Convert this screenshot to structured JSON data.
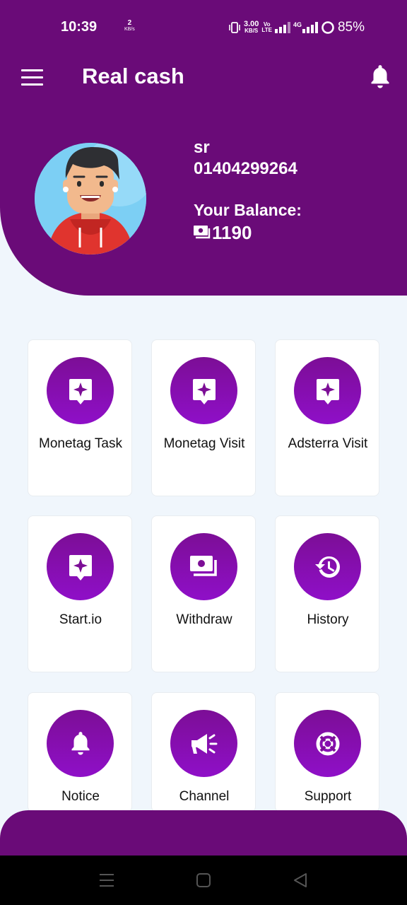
{
  "status_bar": {
    "time": "10:39",
    "net_speed_left_value": "2",
    "net_speed_left_unit": "KB/s",
    "net_speed_right_value": "3.00",
    "net_speed_right_unit": "KB/S",
    "volte_top": "Vo",
    "volte_bottom": "LTE",
    "network_type": "4G",
    "battery": "85%"
  },
  "app_bar": {
    "title": "Real cash",
    "menu_icon": "menu-icon",
    "notification_icon": "bell-icon"
  },
  "profile": {
    "name": "sr",
    "phone": "01404299264",
    "balance_label": "Your Balance:",
    "balance_value": "1190",
    "balance_icon": "money-icon"
  },
  "tiles": [
    {
      "label": "Monetag Task",
      "icon": "sparkle-message-icon"
    },
    {
      "label": "Monetag Visit",
      "icon": "sparkle-message-icon"
    },
    {
      "label": "Adsterra Visit",
      "icon": "sparkle-message-icon"
    },
    {
      "label": "Start.io",
      "icon": "sparkle-message-icon"
    },
    {
      "label": "Withdraw",
      "icon": "money-icon"
    },
    {
      "label": "History",
      "icon": "history-icon"
    },
    {
      "label": "Notice",
      "icon": "bell-icon"
    },
    {
      "label": "Channel",
      "icon": "megaphone-icon"
    },
    {
      "label": "Support",
      "icon": "lifebuoy-icon"
    }
  ],
  "colors": {
    "primary": "#6a0b78",
    "accent_gradient_top": "#7c0e96",
    "accent_gradient_bottom": "#8f0fc8",
    "background": "#f0f6fc"
  }
}
